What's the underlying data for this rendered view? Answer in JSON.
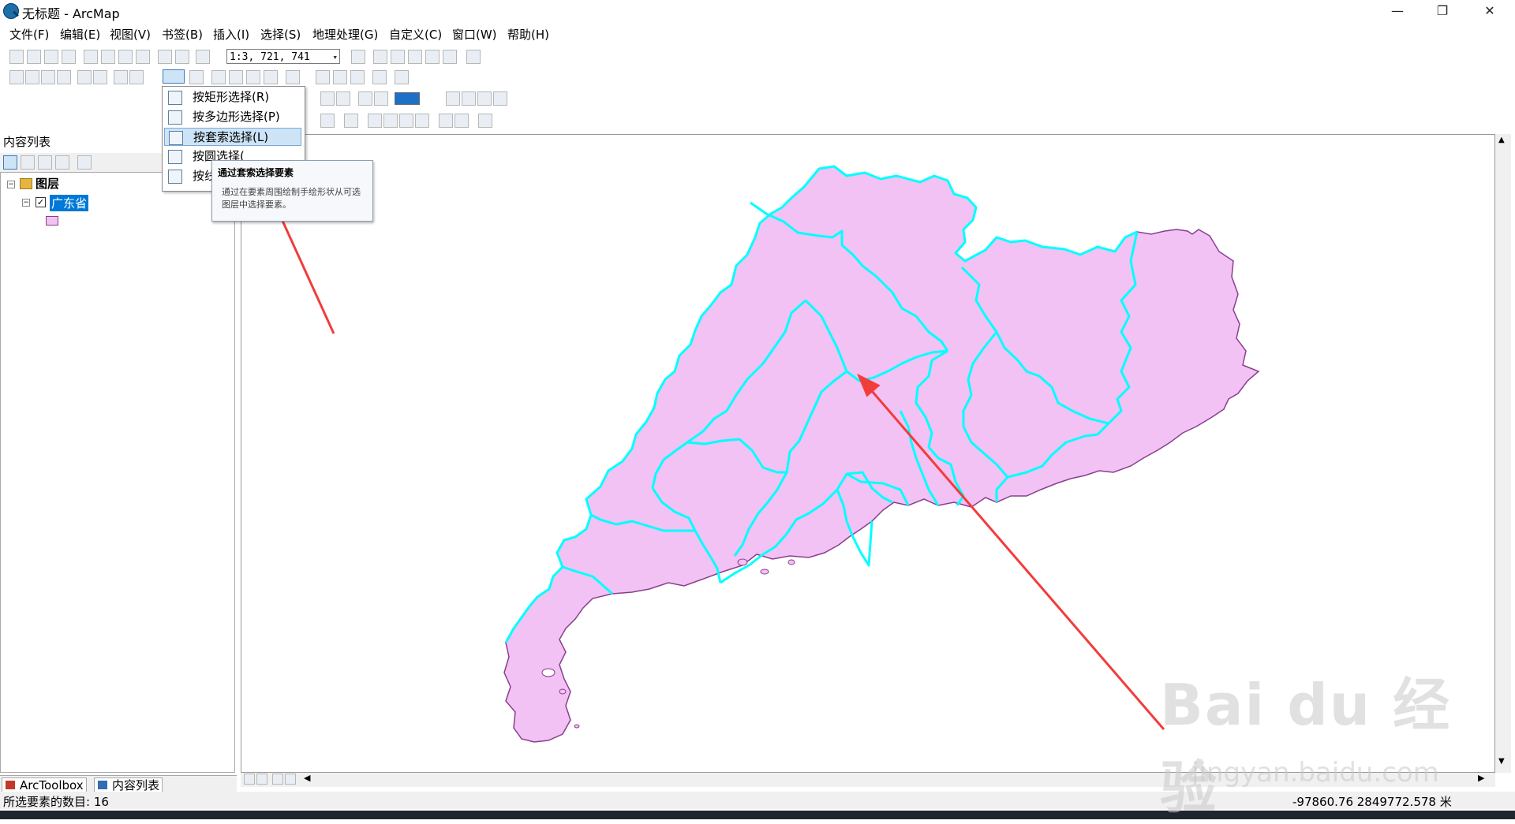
{
  "window": {
    "title": "无标题 - ArcMap",
    "controls": [
      "—",
      "❐",
      "✕"
    ]
  },
  "menubar": [
    "文件(F)",
    "编辑(E)",
    "视图(V)",
    "书签(B)",
    "插入(I)",
    "选择(S)",
    "地理处理(G)",
    "自定义(C)",
    "窗口(W)",
    "帮助(H)"
  ],
  "toolbar": {
    "scale_value": "1:3, 721, 741"
  },
  "select_menu": {
    "items": [
      {
        "label": "按矩形选择(R)",
        "icon": "rectangle-select-icon"
      },
      {
        "label": "按多边形选择(P)",
        "icon": "polygon-select-icon"
      },
      {
        "label": "按套索选择(L)",
        "icon": "lasso-select-icon"
      },
      {
        "label": "按圆选择(C)",
        "icon": "circle-select-icon"
      },
      {
        "label": "按线选择(N)",
        "icon": "line-select-icon"
      }
    ],
    "visible_labels": [
      "按矩形选择(R)",
      "按多边形选择(P)",
      "按套索选择(L)",
      "按圆选择(",
      "按线"
    ]
  },
  "tooltip": {
    "title": "通过套索选择要素",
    "body": "通过在要素周围绘制手绘形状从可选图层中选择要素。"
  },
  "toc": {
    "title": "内容列表",
    "layers_label": "图层",
    "layer_name": "广东省",
    "tabs": [
      "ArcToolbox",
      "内容列表"
    ]
  },
  "status": {
    "selected_count": "所选要素的数目: 16",
    "coordinates": "-97860.76  2849772.578 米"
  },
  "colors": {
    "polygon_fill": "#f1c2f3",
    "polygon_outline": "#8a3e90",
    "selection_outline": "#00ffff",
    "annotation_arrow": "#f23c3c",
    "layer_highlight": "#0078d7"
  },
  "watermark": {
    "logo": "Bai du 经验",
    "url": "jingyan.baidu.com"
  }
}
